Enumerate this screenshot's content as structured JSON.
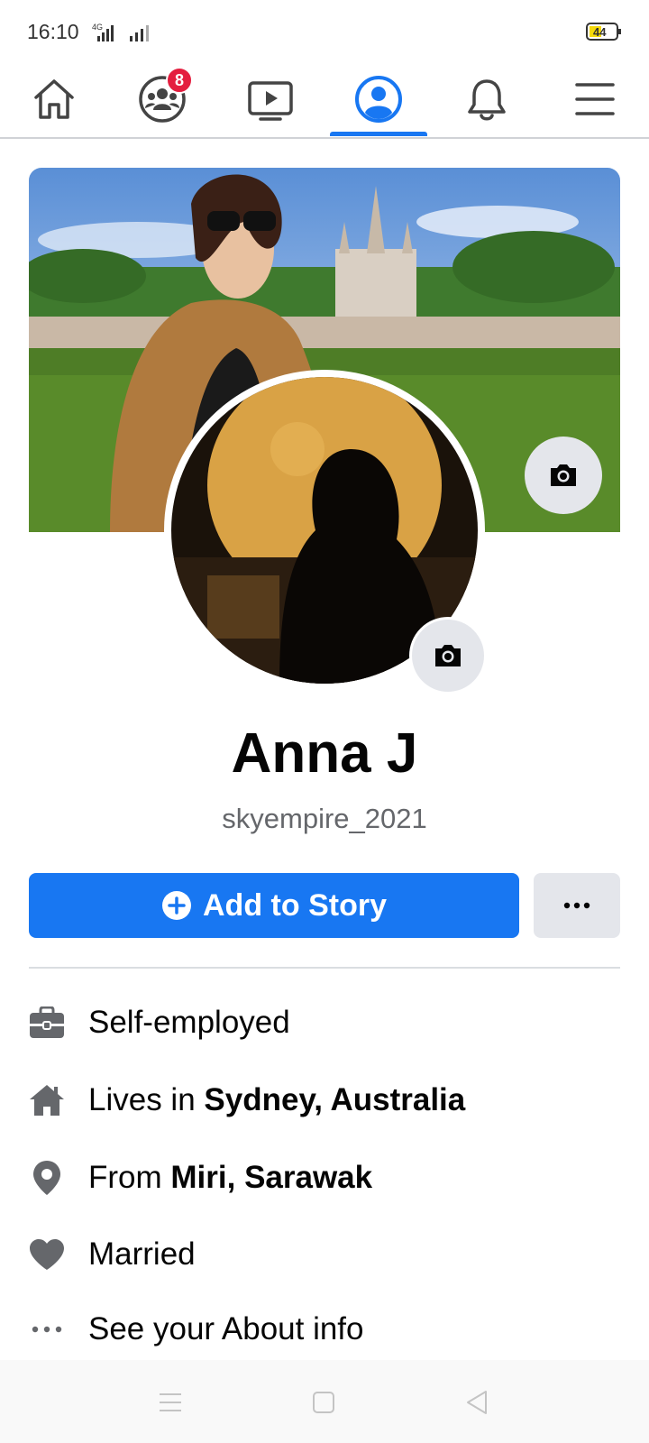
{
  "status_bar": {
    "time": "16:10",
    "network": "4G",
    "battery": "44"
  },
  "nav": {
    "items": [
      "home",
      "groups",
      "watch",
      "profile",
      "notifications",
      "menu"
    ],
    "groups_badge": "8",
    "active": "profile"
  },
  "profile": {
    "name": "Anna J",
    "username": "skyempire_2021"
  },
  "actions": {
    "add_story_label": "Add to Story"
  },
  "intro": {
    "work": "Self-employed",
    "lives_prefix": "Lives in ",
    "lives_place": "Sydney, Australia",
    "from_prefix": "From ",
    "from_place": "Miri, Sarawak",
    "relationship": "Married",
    "about": "See your About info"
  },
  "colors": {
    "accent": "#1877f2",
    "badge": "#e41e3f",
    "icon_gray": "#65676b"
  }
}
